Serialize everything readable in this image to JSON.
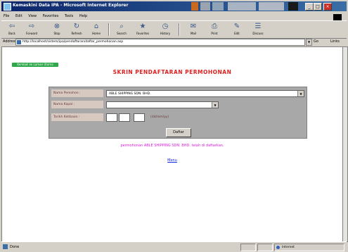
{
  "window": {
    "title": "Kemaskini Data IPA - Microsoft Internet Explorer",
    "controls": [
      "_",
      "□",
      "×"
    ]
  },
  "menu": [
    "File",
    "Edit",
    "View",
    "Favorites",
    "Tools",
    "Help"
  ],
  "toolbar": [
    {
      "label": "Back",
      "icon": "back-arrow-icon"
    },
    {
      "label": "Forward",
      "icon": "forward-arrow-icon"
    },
    {
      "label": "Stop",
      "icon": "stop-icon"
    },
    {
      "label": "Refresh",
      "icon": "refresh-icon"
    },
    {
      "label": "Home",
      "icon": "home-icon"
    },
    {
      "label": "Search",
      "icon": "search-icon"
    },
    {
      "label": "Favorites",
      "icon": "favorites-icon"
    },
    {
      "label": "History",
      "icon": "history-icon"
    },
    {
      "label": "Mail",
      "icon": "mail-icon"
    },
    {
      "label": "Print",
      "icon": "print-icon"
    },
    {
      "label": "Edit",
      "icon": "edit-icon"
    },
    {
      "label": "Discuss",
      "icon": "discuss-icon"
    }
  ],
  "address": {
    "label": "Address",
    "url": "http://localhost/sistem/ipa/pendaftaran/daftar_permohonan.asp",
    "go_label": "Go",
    "links_label": "Links"
  },
  "page": {
    "badge": "Kembali ke Laman Utama",
    "title": "SKRIN PENDAFTARAN PERMOHONAN",
    "form": {
      "applicant_label": "Nama Pemohon :",
      "applicant_value": "ABLE SHIPPING SDN. BHD.",
      "vessel_label": "Nama Kapal :",
      "vessel_value": "",
      "arrival_label": "Tarikh Ketibaan :",
      "date_format": "(dd/mm/yy)",
      "submit_label": "Daftar"
    },
    "message": "permohonan ABLE SHIPPING SDN. BHD. telah di daftarkan.",
    "link": "Menu"
  },
  "status": {
    "text": "Done",
    "zone": "Internet"
  }
}
